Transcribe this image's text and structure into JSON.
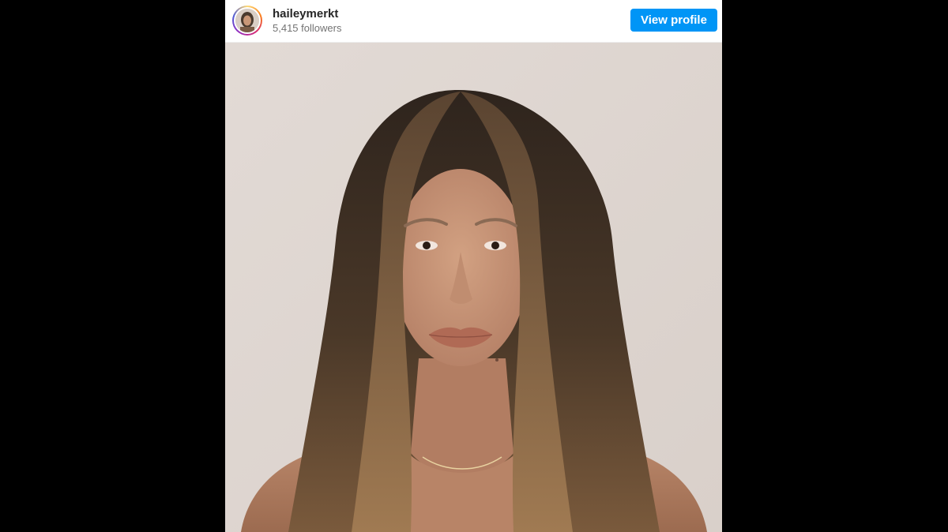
{
  "post": {
    "username": "haileymerkt",
    "followers": "5,415 followers",
    "view_profile_label": "View profile"
  },
  "colors": {
    "page_background": "#000000",
    "button": "#0095f6",
    "username_text": "#262626",
    "secondary_text": "#737373"
  },
  "icons": {
    "avatar": "profile-avatar",
    "photo": "portrait-photo"
  }
}
